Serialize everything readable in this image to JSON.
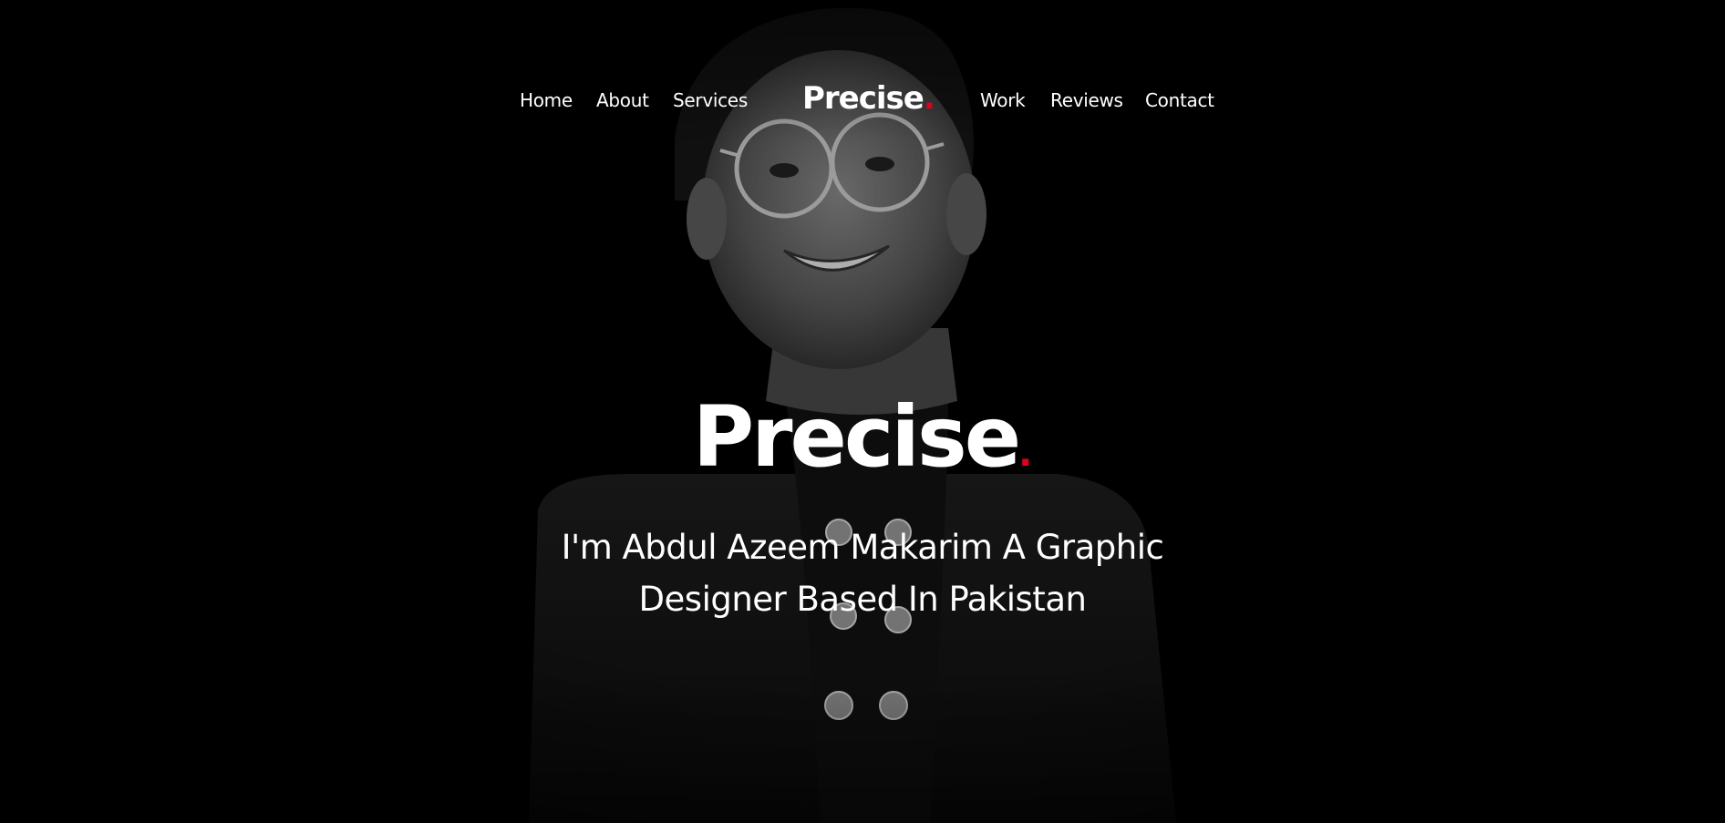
{
  "nav": {
    "left": [
      "Home",
      "About",
      "Services"
    ],
    "brand": "Precise",
    "brand_dot": ".",
    "right": [
      "Work",
      "Reviews",
      "Contact"
    ]
  },
  "hero": {
    "title": "Precise",
    "title_dot": ".",
    "tagline_line1": "I'm Abdul Azeem Makarim A Graphic",
    "tagline_line2": "Designer Based In Pakistan"
  },
  "colors": {
    "background": "#000000",
    "text": "#ffffff",
    "accent": "#e0001b"
  }
}
